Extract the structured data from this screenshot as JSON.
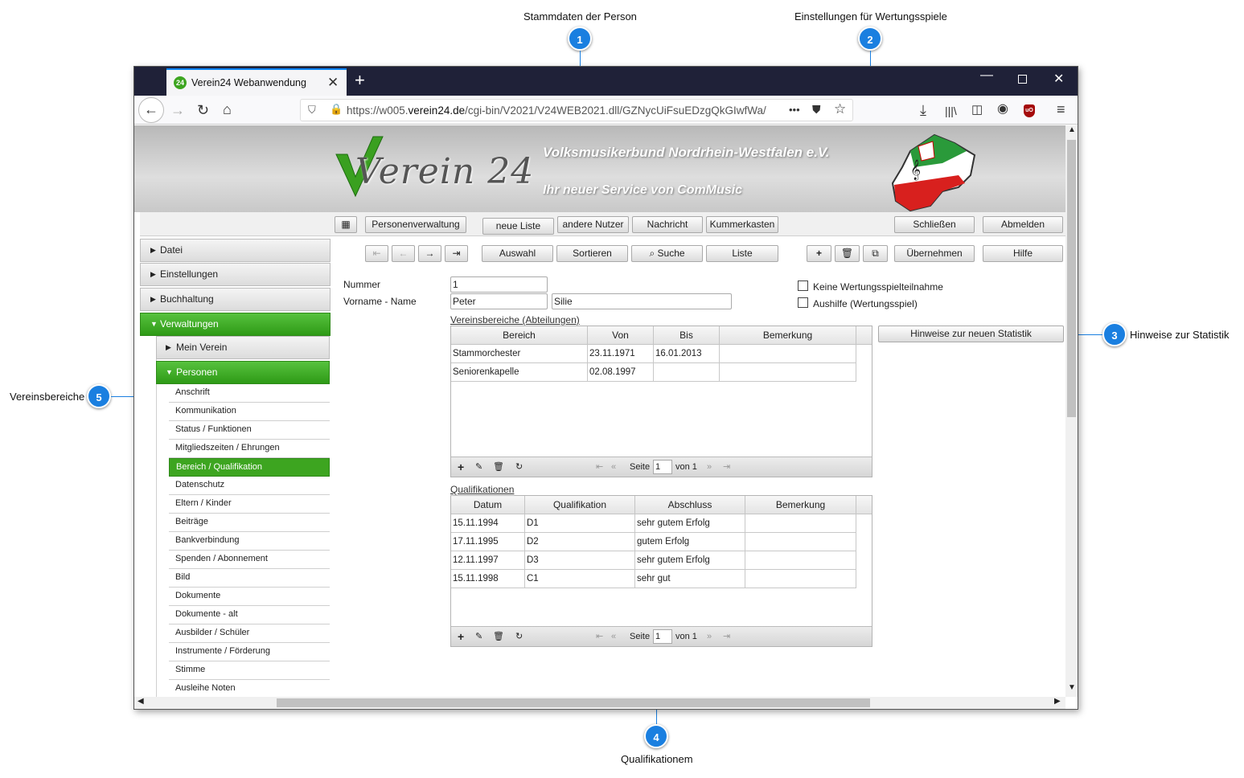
{
  "annotations": {
    "c1": {
      "number": "1",
      "label": "Stammdaten der Person"
    },
    "c2": {
      "number": "2",
      "label": "Einstellungen für Wertungsspiele"
    },
    "c3": {
      "number": "3",
      "label": "Hinweise zur Statistik"
    },
    "c4": {
      "number": "4",
      "label": "Qualifikationem"
    },
    "c5": {
      "number": "5",
      "label": "Vereinsbereiche"
    }
  },
  "browser": {
    "tab_title": "Verein24 Webanwendung",
    "tab_icon": "24",
    "url_prefix": "https://w005.",
    "url_domain": "verein24.de",
    "url_path": "/cgi-bin/V2021/V24WEB2021.dll/GZNycUiFsuEDzgQkGIwfWa/",
    "url_more": "•••"
  },
  "banner": {
    "logo_text": "Verein 24",
    "org_name": "Volksmusikerbund Nordrhein-Westfalen e.V.",
    "slogan": "Ihr neuer Service von ComMusic"
  },
  "menubar": {
    "personenverwaltung": "Personenverwaltung",
    "neue_liste": "neue Liste",
    "andere_nutzer": "andere Nutzer",
    "nachricht": "Nachricht",
    "kummerkasten": "Kummerkasten",
    "schliessen": "Schließen",
    "abmelden": "Abmelden"
  },
  "toolbar": {
    "auswahl": "Auswahl",
    "sortieren": "Sortieren",
    "suche": "Suche",
    "liste": "Liste",
    "uebernehmen": "Übernehmen",
    "hilfe": "Hilfe"
  },
  "sidebar": {
    "datei": "Datei",
    "einstellungen": "Einstellungen",
    "buchhaltung": "Buchhaltung",
    "verwaltungen": "Verwaltungen",
    "mein_verein": "Mein Verein",
    "personen": "Personen",
    "items": [
      "Anschrift",
      "Kommunikation",
      "Status / Funktionen",
      "Mitgliedszeiten / Ehrungen",
      "Bereich / Qualifikation",
      "Datenschutz",
      "Eltern / Kinder",
      "Beiträge",
      "Bankverbindung",
      "Spenden / Abonnement",
      "Bild",
      "Dokumente",
      "Dokumente - alt",
      "Ausbilder / Schüler",
      "Instrumente / Förderung",
      "Stimme",
      "Ausleihe Noten"
    ]
  },
  "form": {
    "nummer_label": "Nummer",
    "nummer_value": "1",
    "name_label": "Vorname - Name",
    "vorname": "Peter",
    "nachname": "Silie",
    "keine_wertung": "Keine Wertungsspielteilnahme",
    "aushilfe": "Aushilfe (Wertungsspiel)",
    "hinweise_button": "Hinweise zur neuen Statistik"
  },
  "vereinsbereiche": {
    "title": "Vereinsbereiche (Abteilungen)",
    "headers": [
      "Bereich",
      "Von",
      "Bis",
      "Bemerkung"
    ],
    "rows": [
      [
        "Stammorchester",
        "23.11.1971",
        "16.01.2013",
        ""
      ],
      [
        "Seniorenkapelle",
        "02.08.1997",
        "",
        ""
      ]
    ],
    "pager": {
      "seite": "Seite",
      "page": "1",
      "von": "von 1"
    }
  },
  "qualifikationen": {
    "title": "Qualifikationen",
    "headers": [
      "Datum",
      "Qualifikation",
      "Abschluss",
      "Bemerkung"
    ],
    "rows": [
      [
        "15.11.1994",
        "D1",
        "sehr gutem Erfolg",
        ""
      ],
      [
        "17.11.1995",
        "D2",
        "gutem Erfolg",
        ""
      ],
      [
        "12.11.1997",
        "D3",
        "sehr gutem Erfolg",
        ""
      ],
      [
        "15.11.1998",
        "C1",
        "sehr gut",
        ""
      ]
    ],
    "pager": {
      "seite": "Seite",
      "page": "1",
      "von": "von 1"
    }
  },
  "colors": {
    "accent": "#1a7fe0",
    "green": "#3da520",
    "tabbar": "#1f2138"
  }
}
